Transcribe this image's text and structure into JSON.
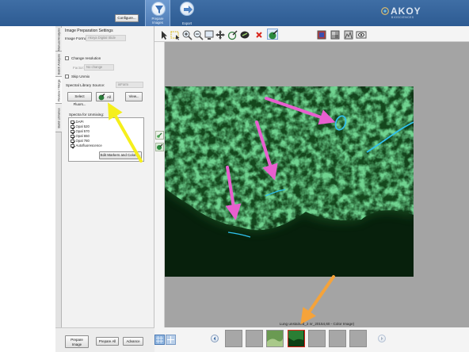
{
  "header": {
    "configure_label": "Configure...",
    "tabs": [
      {
        "label": "Prepare",
        "label2": "Images"
      },
      {
        "label": "Export",
        "label2": ""
      }
    ],
    "logo": {
      "word": "AKOY",
      "sub": "BIOSCIENCES"
    }
  },
  "vertical_tabs": [
    "Manual Analysis",
    "Batch Analysis",
    "Review / Merge",
    "Build Libraries"
  ],
  "settings": {
    "title": "Image Preparation Settings",
    "image_format_label": "Image Format:",
    "image_format_value": "Akoya Digital Slide",
    "change_resolution_label": "Change resolution",
    "factor_label": "Factor:",
    "factor_value": "No change",
    "skip_unmix_label": "Skip Unmix",
    "spectral_source_label": "Spectral Library Source:",
    "spectral_source_value": "inForm",
    "select_fluors_label": "Select Fluors...",
    "all_label": "All",
    "view_label": "View...",
    "spectra_label": "Spectra for Unmixing:",
    "spectra": [
      "DAPI",
      "Opal 520",
      "Opal 570",
      "Opal 650",
      "Opal 780",
      "Autofluorescence"
    ],
    "edit_markers_label": "Edit Markers and Colors..."
  },
  "toolbar": {
    "icons": [
      "pointer-icon",
      "region-select-icon",
      "zoom-in-icon",
      "zoom-out-icon",
      "fit-screen-icon",
      "pan-icon",
      "eyedropper-add-icon",
      "eyedropper-remove-icon",
      "delete-icon",
      "spectra-pick-icon",
      "color-composite-icon",
      "grayscale-icon",
      "eye-view-icon"
    ]
  },
  "viewer": {
    "caption": "Lung unstained_2 nr_20154,60 - Color Image)"
  },
  "bottom": {
    "prepare_image_label": "Prepare",
    "prepare_image_label2": "Image",
    "prepare_all_label": "Prepare All",
    "advance_label": "Advance"
  },
  "annotation_colors": {
    "pink": "#e85fcf",
    "yellow": "#f5ef1c",
    "orange": "#f5a33a"
  },
  "colors": {
    "header_blue": "#3f6ea5",
    "tissue_green": "#2e8b35",
    "highlight_cyan": "#2fc2ee"
  }
}
